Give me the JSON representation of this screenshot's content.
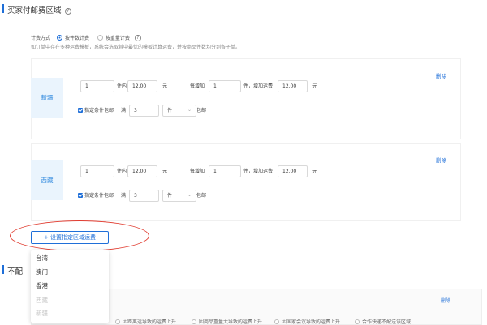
{
  "section1": {
    "title": "买家付邮费区域"
  },
  "billing": {
    "label": "计费方式",
    "options": [
      "按件数计费",
      "按重量计费"
    ],
    "selected": 0,
    "note": "如订单中存在多种运费模板，系统会选取其中最优的模板计算运费，并按商品件数均分到各子单。"
  },
  "rules": [
    {
      "region": "新疆",
      "first_qty": "1",
      "first_unit": "件内",
      "first_fee": "12.00",
      "yuan": "元",
      "each_add_label": "每增加",
      "add_qty": "1",
      "add_fee_label": "件，增加运费",
      "add_fee": "12.00",
      "free_ship_label": "指定条件包邮",
      "full_label": "满",
      "full_qty": "3",
      "unit_select": "件",
      "free_suffix": "包邮",
      "delete_label": "删除"
    },
    {
      "region": "西藏",
      "first_qty": "1",
      "first_unit": "件内",
      "first_fee": "12.00",
      "yuan": "元",
      "each_add_label": "每增加",
      "add_qty": "1",
      "add_fee_label": "件，增加运费",
      "add_fee": "12.00",
      "free_ship_label": "指定条件包邮",
      "full_label": "满",
      "full_qty": "3",
      "unit_select": "件",
      "free_suffix": "包邮",
      "delete_label": "删除"
    }
  ],
  "add_button": {
    "label": "+ 设置指定区域运费"
  },
  "dropdown": {
    "items": [
      {
        "label": "台湾",
        "disabled": false
      },
      {
        "label": "澳门",
        "disabled": false
      },
      {
        "label": "香港",
        "disabled": false
      },
      {
        "label": "西藏",
        "disabled": true
      },
      {
        "label": "新疆",
        "disabled": true
      }
    ]
  },
  "section2": {
    "title_visible": "不配"
  },
  "bottom": {
    "delete_label": "删除",
    "options": [
      "因距离远导致的运费上升",
      "因商品重量大导致的运费上升",
      "因国家会议导致的运费上升",
      "合作快递不配送该区域"
    ]
  },
  "colors": {
    "accent": "#1f6fd8",
    "highlight": "#e03b2f",
    "region_bg": "#eaf4fd"
  }
}
